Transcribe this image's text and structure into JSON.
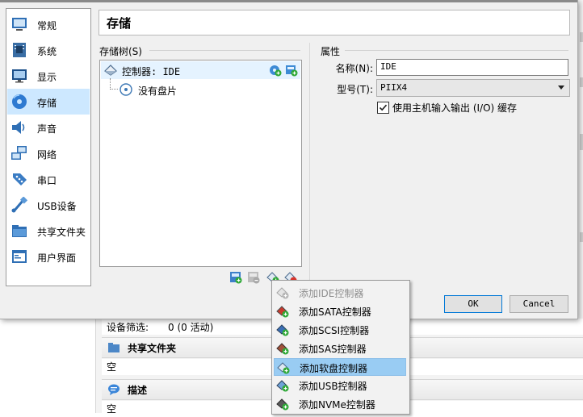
{
  "background": {
    "device_filter_label": "设备筛选:",
    "device_filter_value": "0 (0 活动)",
    "shared_folders_title": "共享文件夹",
    "shared_folders_value": "空",
    "description_title": "描述",
    "description_value": "空"
  },
  "sidebar": {
    "items": [
      {
        "label": "常规",
        "icon": "general-icon"
      },
      {
        "label": "系统",
        "icon": "system-chip-icon"
      },
      {
        "label": "显示",
        "icon": "display-monitor-icon"
      },
      {
        "label": "存储",
        "icon": "storage-disk-icon",
        "selected": true
      },
      {
        "label": "声音",
        "icon": "speaker-icon"
      },
      {
        "label": "网络",
        "icon": "network-icon"
      },
      {
        "label": "串口",
        "icon": "serial-port-icon"
      },
      {
        "label": "USB设备",
        "icon": "usb-icon"
      },
      {
        "label": "共享文件夹",
        "icon": "folder-icon"
      },
      {
        "label": "用户界面",
        "icon": "user-interface-icon"
      }
    ]
  },
  "page": {
    "title": "存储"
  },
  "storage_tree": {
    "label": "存储树(S)",
    "controller_label": "控制器: IDE",
    "empty_disk_label": "没有盘片"
  },
  "attributes": {
    "label": "属性",
    "name_label": "名称(N):",
    "name_value": "IDE",
    "type_label": "型号(T):",
    "type_value": "PIIX4",
    "use_host_io_label": "使用主机输入输出 (I/O) 缓存",
    "use_host_io_checked": true
  },
  "buttons": {
    "ok": "OK",
    "cancel": "Cancel"
  },
  "context_menu": {
    "items": [
      {
        "label": "添加IDE控制器",
        "disabled": true
      },
      {
        "label": "添加SATA控制器"
      },
      {
        "label": "添加SCSI控制器"
      },
      {
        "label": "添加SAS控制器"
      },
      {
        "label": "添加软盘控制器",
        "highlighted": true
      },
      {
        "label": "添加USB控制器"
      },
      {
        "label": "添加NVMe控制器"
      }
    ]
  },
  "colors": {
    "selection": "#cde8ff",
    "menu_highlight": "#99ccf3",
    "ok_border": "#0078d7",
    "add_green": "#2ea836"
  }
}
